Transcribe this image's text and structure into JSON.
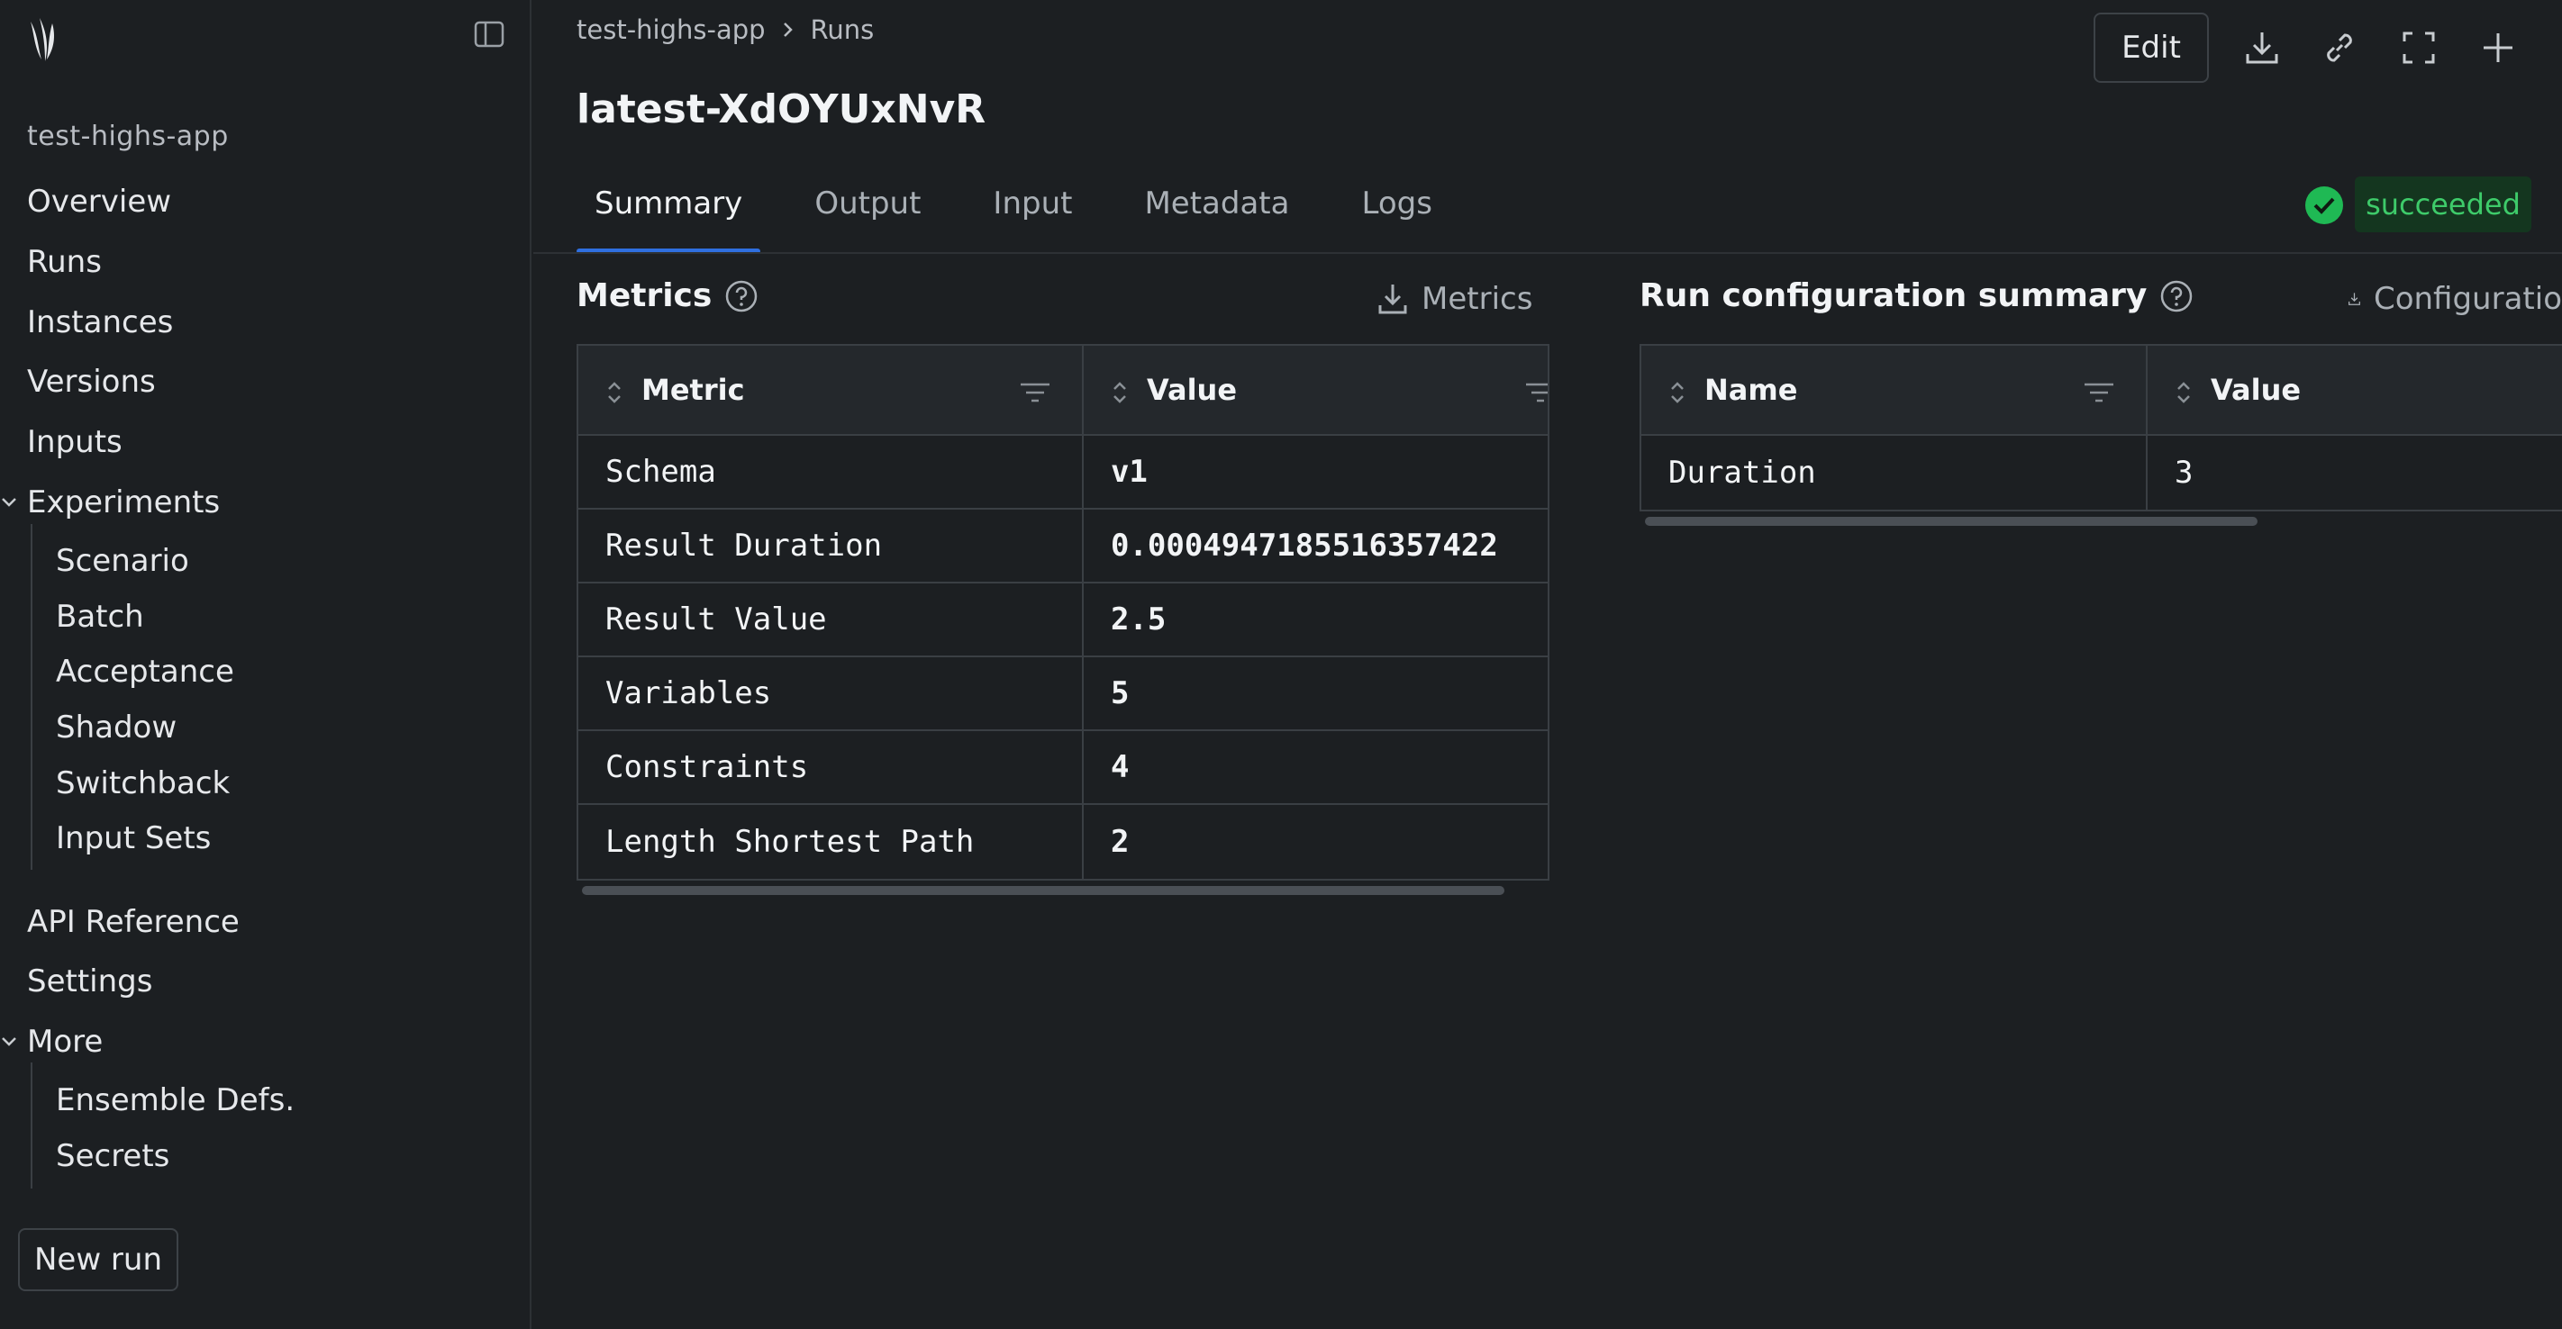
{
  "sidebar": {
    "app_label": "test-highs-app",
    "nav": {
      "overview": "Overview",
      "runs": "Runs",
      "instances": "Instances",
      "versions": "Versions",
      "inputs": "Inputs",
      "experiments": "Experiments",
      "scenario": "Scenario",
      "batch": "Batch",
      "acceptance": "Acceptance",
      "shadow": "Shadow",
      "switchback": "Switchback",
      "input_sets": "Input Sets",
      "api_reference": "API Reference",
      "settings": "Settings",
      "more": "More",
      "ensemble_defs": "Ensemble Defs.",
      "secrets": "Secrets"
    },
    "new_run_label": "New run"
  },
  "header": {
    "breadcrumb_app": "test-highs-app",
    "breadcrumb_section": "Runs",
    "title": "latest-XdOYUxNvR",
    "edit_label": "Edit"
  },
  "tabs": {
    "summary": "Summary",
    "output": "Output",
    "input": "Input",
    "metadata": "Metadata",
    "logs": "Logs"
  },
  "status": {
    "label": "succeeded",
    "color": "#3ecb6a"
  },
  "metrics": {
    "title": "Metrics",
    "download_label": "Metrics",
    "columns": {
      "metric": "Metric",
      "value": "Value"
    },
    "rows": [
      {
        "metric": "Schema",
        "value": "v1"
      },
      {
        "metric": "Result Duration",
        "value": "0.0004947185516357422"
      },
      {
        "metric": "Result Value",
        "value": "2.5"
      },
      {
        "metric": "Variables",
        "value": "5"
      },
      {
        "metric": "Constraints",
        "value": "4"
      },
      {
        "metric": "Length Shortest Path",
        "value": "2"
      }
    ]
  },
  "run_config": {
    "title": "Run configuration summary",
    "download_label": "Configuratio",
    "columns": {
      "name": "Name",
      "value": "Value"
    },
    "rows": [
      {
        "name": "Duration",
        "value": "3"
      }
    ]
  },
  "accent_color": "#2f6fe0"
}
